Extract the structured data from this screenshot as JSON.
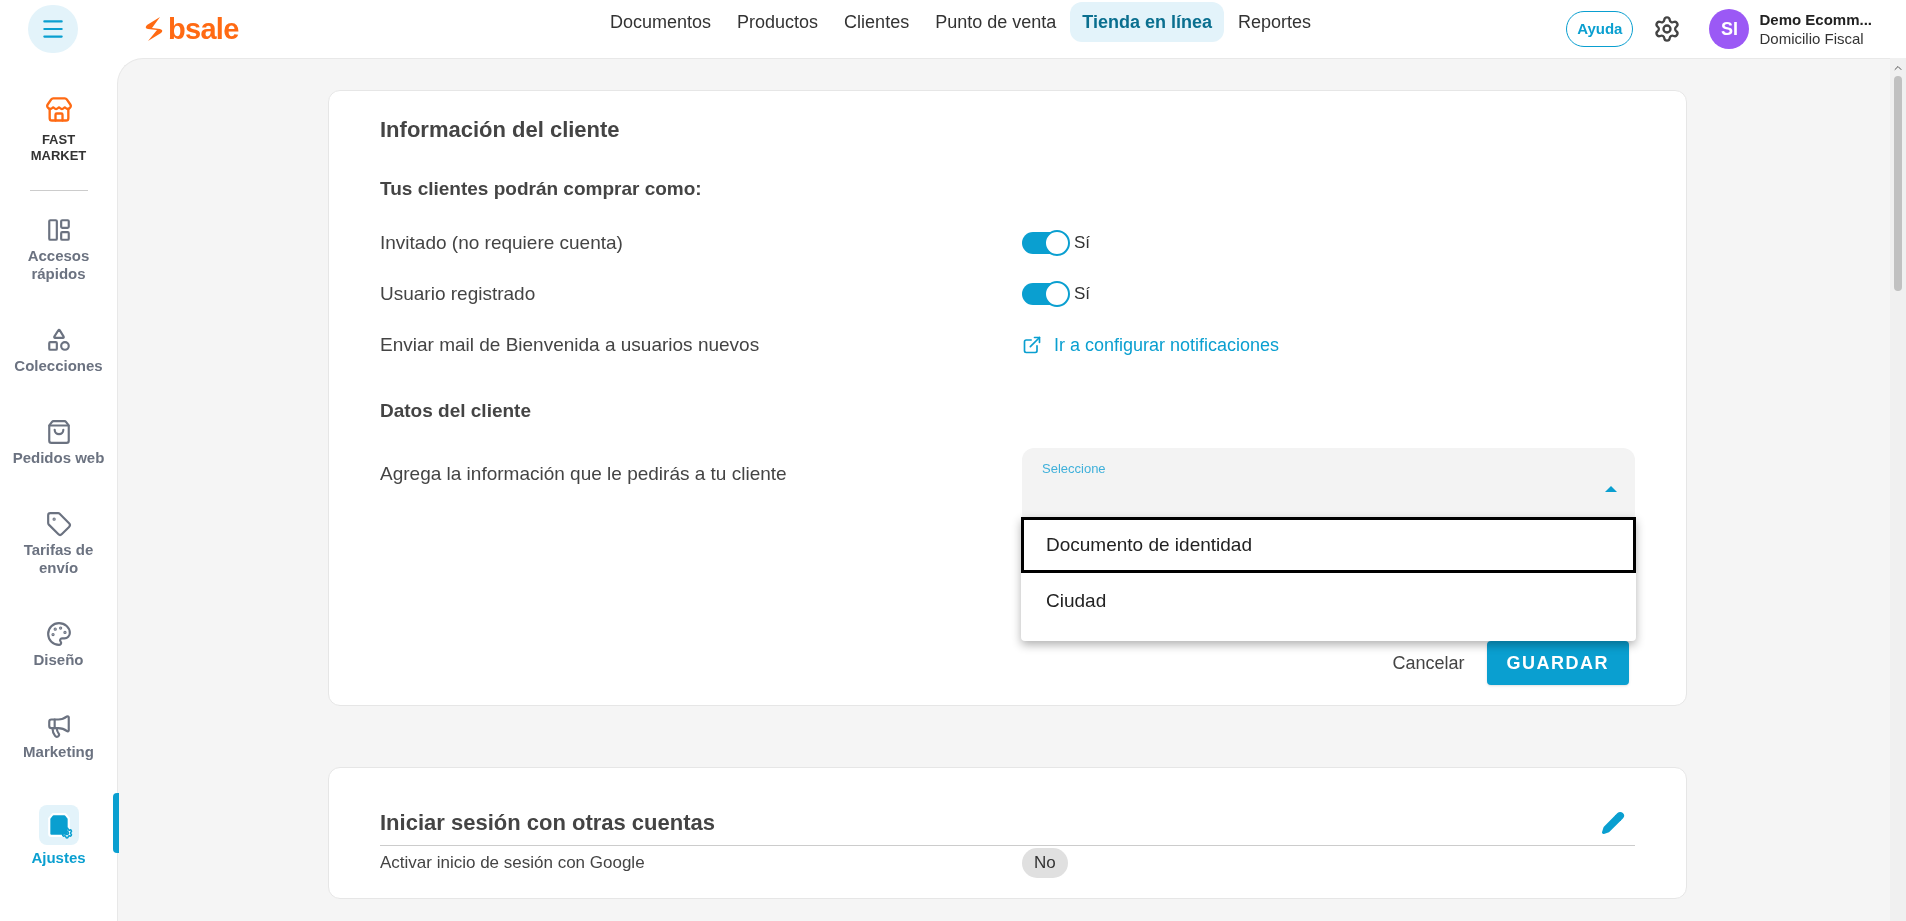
{
  "header": {
    "brand": "bsale",
    "nav": [
      {
        "label": "Documentos",
        "selected": false
      },
      {
        "label": "Productos",
        "selected": false
      },
      {
        "label": "Clientes",
        "selected": false
      },
      {
        "label": "Punto de venta",
        "selected": false
      },
      {
        "label": "Tienda en línea",
        "selected": true
      },
      {
        "label": "Reportes",
        "selected": false
      }
    ],
    "help": "Ayuda",
    "user": {
      "initials": "SI",
      "name": "Demo Ecomm...",
      "subtitle": "Domicilio Fiscal"
    }
  },
  "store": {
    "name": "FAST MARKET"
  },
  "sidebar": {
    "items": [
      {
        "kind": "layout",
        "label": "Accesos rápidos",
        "selected": false
      },
      {
        "kind": "shapes",
        "label": "Colecciones",
        "selected": false
      },
      {
        "kind": "bag",
        "label": "Pedidos web",
        "selected": false
      },
      {
        "kind": "tag",
        "label": "Tarifas de envío",
        "selected": false
      },
      {
        "kind": "palette",
        "label": "Diseño",
        "selected": false
      },
      {
        "kind": "megaphone",
        "label": "Marketing",
        "selected": false
      },
      {
        "kind": "settings",
        "label": "Ajustes",
        "selected": true
      }
    ]
  },
  "client_info": {
    "title": "Información del cliente",
    "subtitle": "Tus clientes podrán comprar como:",
    "rows": [
      {
        "kind": "toggle",
        "label": "Invitado (no requiere cuenta)",
        "on": true,
        "value": "Sí"
      },
      {
        "kind": "toggle",
        "label": "Usuario registrado",
        "on": true,
        "value": "Sí"
      },
      {
        "kind": "link",
        "label": "Enviar mail de Bienvenida a usuarios nuevos",
        "link": "Ir a configurar notificaciones"
      }
    ],
    "section": "Datos del cliente",
    "field_label": "Agrega la información que le pedirás a tu cliente",
    "select": {
      "label": "Seleccione",
      "expanded": true,
      "options": [
        {
          "label": "Documento de identidad",
          "selected": true
        },
        {
          "label": "Ciudad",
          "selected": false
        }
      ]
    },
    "cancel": "Cancelar",
    "save": "GUARDAR"
  },
  "other_accounts": {
    "title": "Iniciar sesión con otras cuentas",
    "rows": [
      {
        "label": "Activar inicio de sesión con Google",
        "value": "No"
      }
    ]
  }
}
